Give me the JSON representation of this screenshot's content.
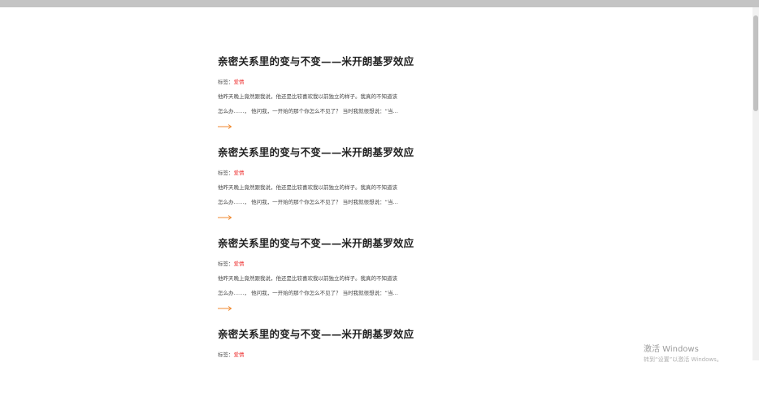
{
  "articles": [
    {
      "title": "亲密关系里的变与不变——米开朗基罗效应",
      "tag_label": "标签：",
      "tag": "爱情",
      "excerpt_line1": "他昨天晚上竟然跟我说，他还是比较喜欢我以前独立的样子。我真的不知道该",
      "excerpt_line2": "怎么办……， 他问我，一开始的那个你怎么不见了？ 当时我就很想说：“当…",
      "arrow_icon": "arrow-right-icon"
    },
    {
      "title": "亲密关系里的变与不变——米开朗基罗效应",
      "tag_label": "标签：",
      "tag": "爱情",
      "excerpt_line1": "他昨天晚上竟然跟我说，他还是比较喜欢我以前独立的样子。我真的不知道该",
      "excerpt_line2": "怎么办……， 他问我，一开始的那个你怎么不见了？ 当时我就很想说：“当…",
      "arrow_icon": "arrow-right-icon"
    },
    {
      "title": "亲密关系里的变与不变——米开朗基罗效应",
      "tag_label": "标签：",
      "tag": "爱情",
      "excerpt_line1": "他昨天晚上竟然跟我说，他还是比较喜欢我以前独立的样子。我真的不知道该",
      "excerpt_line2": "怎么办……， 他问我，一开始的那个你怎么不见了？ 当时我就很想说：“当…",
      "arrow_icon": "arrow-right-icon"
    },
    {
      "title": "亲密关系里的变与不变——米开朗基罗效应",
      "tag_label": "标签：",
      "tag": "爱情"
    }
  ],
  "watermark": {
    "line1": "激活 Windows",
    "line2": "转到“设置”以激活 Windows。"
  },
  "colors": {
    "tag": "#ee3333",
    "arrow": "#f08a30",
    "topbar": "#c4c4c4"
  }
}
